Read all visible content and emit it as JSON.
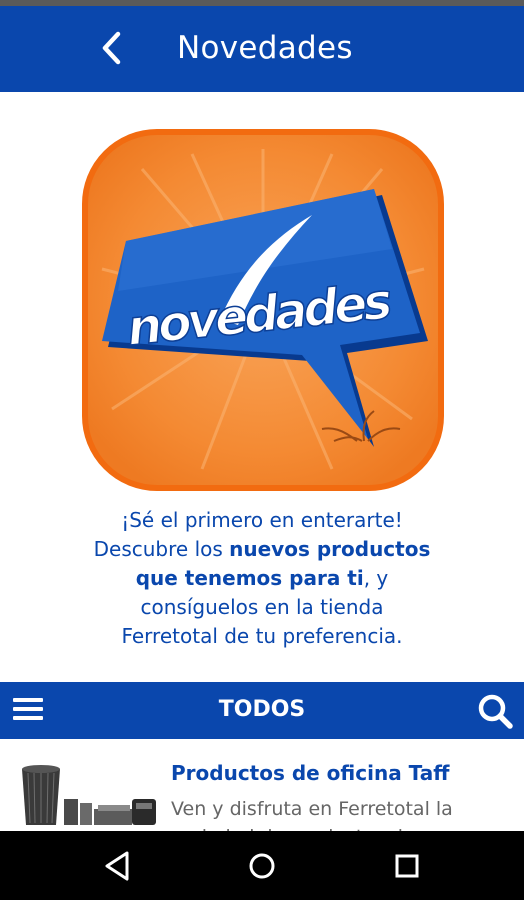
{
  "app_bar": {
    "title": "Novedades",
    "back_icon": "chevron-left-icon"
  },
  "hero": {
    "logo_text": "novedades",
    "colors": {
      "orange": "#f47a1f",
      "blue": "#0a47ad"
    }
  },
  "intro": {
    "line1": "¡Sé el primero en enterarte!",
    "line2_prefix": "Descubre los ",
    "line2_bold": "nuevos productos",
    "line3_bold": "que tenemos para ti",
    "line3_suffix": ", y",
    "line4": "consíguelos en la tienda",
    "line5": "Ferretotal de tu preferencia."
  },
  "filter_bar": {
    "label": "TODOS",
    "menu_icon": "hamburger-menu-icon",
    "search_icon": "search-icon"
  },
  "list": {
    "items": [
      {
        "title": "Productos de oficina Taff",
        "description": "Ven y disfruta en Ferretotal la variedad de productos de"
      }
    ]
  },
  "nav_bar": {
    "back_icon": "nav-back-icon",
    "home_icon": "nav-home-icon",
    "recents_icon": "nav-recents-icon"
  },
  "colors": {
    "primary_blue": "#0a47ad",
    "accent_orange": "#f47a1f"
  }
}
